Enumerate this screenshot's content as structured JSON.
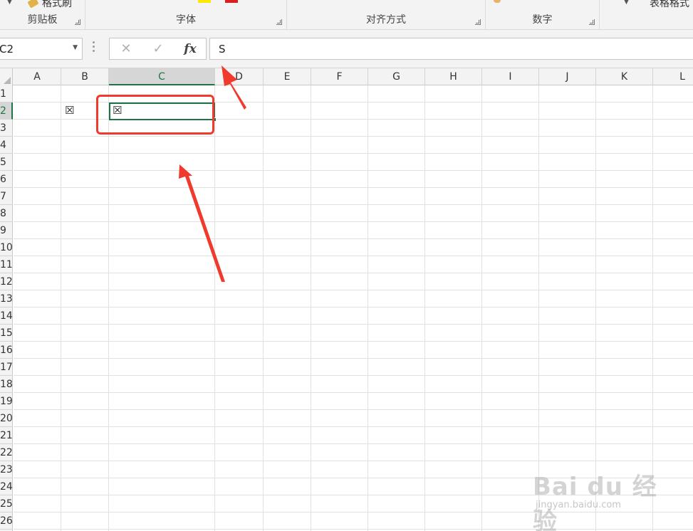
{
  "ribbon": {
    "format_painter": "格式刷",
    "table_style": "表格格式",
    "groups": [
      {
        "key": "clipboard",
        "label": "剪贴板"
      },
      {
        "key": "font",
        "label": "字体"
      },
      {
        "key": "alignment",
        "label": "对齐方式"
      },
      {
        "key": "number",
        "label": "数字"
      }
    ]
  },
  "formula_bar": {
    "name_box": "C2",
    "cancel_icon": "✕",
    "enter_icon": "✓",
    "function_icon": "fx",
    "formula": "S"
  },
  "grid": {
    "columns": [
      "A",
      "B",
      "C",
      "D",
      "E",
      "F",
      "G",
      "H",
      "I",
      "J",
      "K",
      "L"
    ],
    "selected_column": "C",
    "rows": [
      "1",
      "2",
      "3",
      "4",
      "5",
      "6",
      "7",
      "8",
      "9",
      "10",
      "11",
      "12",
      "13",
      "14",
      "15",
      "16",
      "17",
      "18",
      "19",
      "20",
      "21",
      "22",
      "23",
      "24",
      "25",
      "26"
    ],
    "selected_row": "2",
    "cells": {
      "B2": "☒",
      "C2": "☒"
    },
    "active_cell": "C2"
  },
  "colors": {
    "selection": "#217346",
    "annotation": "#f03a2e",
    "ribbon_bg": "#f3f3f3"
  },
  "watermark": {
    "logo": "Bai du 经验",
    "url": "jingyan.baidu.com"
  }
}
